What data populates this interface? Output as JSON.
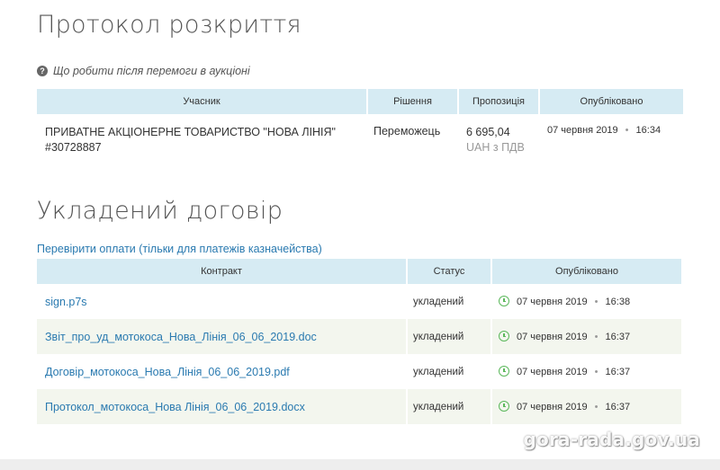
{
  "disclosure": {
    "title": "Протокол розкриття",
    "help_text": "Що робити після перемоги в аукціоні",
    "help_icon": "question-circle-icon",
    "columns": [
      "Учасник",
      "Рішення",
      "Пропозиція",
      "Опубліковано"
    ],
    "row": {
      "participant_name": "ПРИВАТНЕ АКЦІОНЕРНЕ ТОВАРИСТВО \"НОВА ЛІНІЯ\"",
      "participant_id": "#30728887",
      "decision": "Переможець",
      "amount": "6 695,04",
      "currency": "UAH з ПДВ",
      "date": "07 червня 2019",
      "time": "16:34"
    }
  },
  "contract": {
    "title": "Укладений договір",
    "verify_link": "Перевірити оплати (тільки для платежів казначейства)",
    "columns": [
      "Контракт",
      "Статус",
      "Опубліковано"
    ],
    "rows": [
      {
        "file": "sign.p7s",
        "status": "укладений",
        "date": "07 червня 2019",
        "time": "16:38"
      },
      {
        "file": "Звіт_про_уд_мотокоса_Нова_Лінія_06_06_2019.doc",
        "status": "укладений",
        "date": "07 червня 2019",
        "time": "16:37"
      },
      {
        "file": "Договір_мотокоса_Нова_Лінія_06_06_2019.pdf",
        "status": "укладений",
        "date": "07 червня 2019",
        "time": "16:37"
      },
      {
        "file": "Протокол_мотокоса_Нова Лінія_06_06_2019.docx",
        "status": "укладений",
        "date": "07 червня 2019",
        "time": "16:37"
      }
    ]
  },
  "watermark": "gora-rada.gov.ua",
  "colors": {
    "header_bg": "#d6ebf3",
    "link": "#2a7ab0",
    "alt_row": "#f3f6ee",
    "clock": "#5cb85c"
  }
}
